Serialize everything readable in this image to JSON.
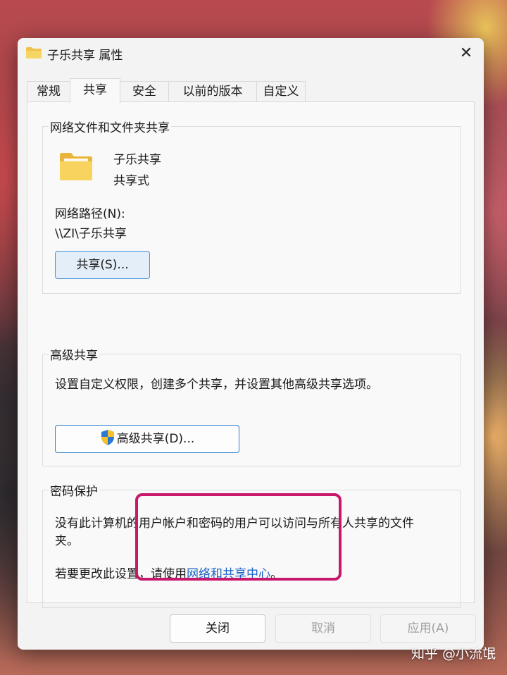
{
  "window": {
    "title": "子乐共享 属性",
    "title_icon": "folder-icon",
    "close_icon": "close-icon",
    "close_glyph": "✕"
  },
  "tabs": [
    {
      "label": "常规",
      "active": false
    },
    {
      "label": "共享",
      "active": true
    },
    {
      "label": "安全",
      "active": false
    },
    {
      "label": "以前的版本",
      "active": false
    },
    {
      "label": "自定义",
      "active": false
    }
  ],
  "network_sharing": {
    "group_title": "网络文件和文件夹共享",
    "folder_name": "子乐共享",
    "share_status": "共享式",
    "path_label": "网络路径(N):",
    "path_value": "\\\\ZI\\子乐共享",
    "share_button": "共享(S)..."
  },
  "advanced_sharing": {
    "group_title": "高级共享",
    "description": "设置自定义权限，创建多个共享，并设置其他高级共享选项。",
    "button": "高级共享(D)...",
    "button_icon": "shield-icon"
  },
  "password_protection": {
    "group_title": "密码保护",
    "description_line1": "没有此计算机的用户帐户和密码的用户可以访问与所有人共享的文件",
    "description_line2": "夹。",
    "change_prefix": "若要更改此设置，请使用",
    "change_link": "网络和共享中心",
    "change_suffix": "。"
  },
  "footer": {
    "close": "关闭",
    "cancel": "取消",
    "apply": "应用(A)"
  },
  "watermark": "知乎 @小流氓",
  "colors": {
    "accent": "#4a90d9",
    "link": "#1a63c6",
    "highlight": "#c8186c"
  }
}
